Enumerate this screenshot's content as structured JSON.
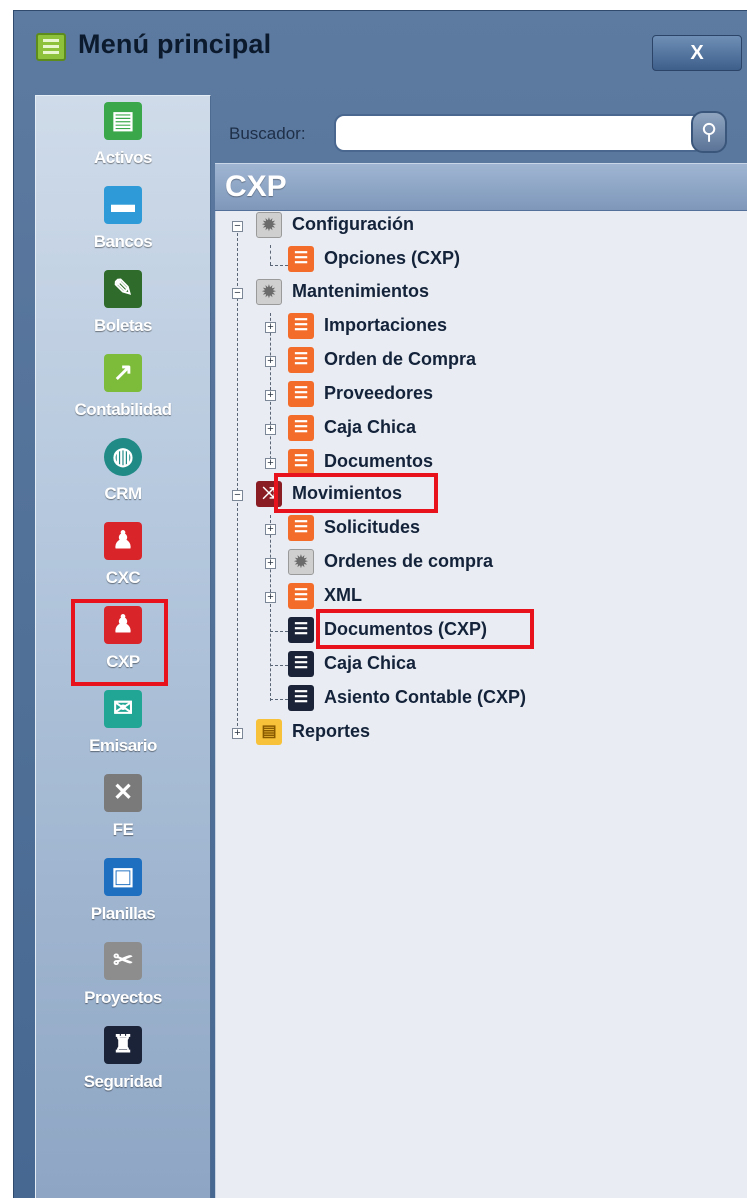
{
  "window": {
    "title": "Menú principal",
    "close_label": "X"
  },
  "sidebar": {
    "modules": [
      {
        "label": "Activos",
        "icon": "cash-register-icon",
        "color": "#3aa84a"
      },
      {
        "label": "Bancos",
        "icon": "briefcase-icon",
        "color": "#2e9bd8"
      },
      {
        "label": "Boletas",
        "icon": "teacher-board-icon",
        "color": "#2f6b2a"
      },
      {
        "label": "Contabilidad",
        "icon": "chart-icon",
        "color": "#7dbb3b"
      },
      {
        "label": "CRM",
        "icon": "globe-icon",
        "color": "#1f8a86"
      },
      {
        "label": "CXC",
        "icon": "person-pushing-icon",
        "color": "#d9252a"
      },
      {
        "label": "CXP",
        "icon": "person-sowing-icon",
        "color": "#d9252a"
      },
      {
        "label": "Emisario",
        "icon": "envelope-icon",
        "color": "#21a595"
      },
      {
        "label": "FE",
        "icon": "wrench-screwdriver-icon",
        "color": "#7a7a7a"
      },
      {
        "label": "Planillas",
        "icon": "document-icon",
        "color": "#1f6fc1"
      },
      {
        "label": "Proyectos",
        "icon": "ruler-pencil-icon",
        "color": "#8d8d8d"
      },
      {
        "label": "Seguridad",
        "icon": "castle-icon",
        "color": "#1b2338"
      }
    ],
    "highlight_color": "#e8121c"
  },
  "search": {
    "label": "Buscador:",
    "value": "",
    "placeholder": ""
  },
  "section": {
    "title": "CXP"
  },
  "tree": {
    "configuracion": {
      "label": "Configuración",
      "children": [
        "Opciones (CXP)"
      ]
    },
    "mantenimientos": {
      "label": "Mantenimientos",
      "children": [
        "Importaciones",
        "Orden de Compra",
        "Proveedores",
        "Caja Chica",
        "Documentos"
      ]
    },
    "movimientos": {
      "label": "Movimientos",
      "children": [
        "Solicitudes",
        "Ordenes de compra",
        "XML",
        "Documentos (CXP)",
        "Caja Chica",
        "Asiento Contable (CXP)"
      ]
    },
    "reportes": {
      "label": "Reportes"
    }
  }
}
